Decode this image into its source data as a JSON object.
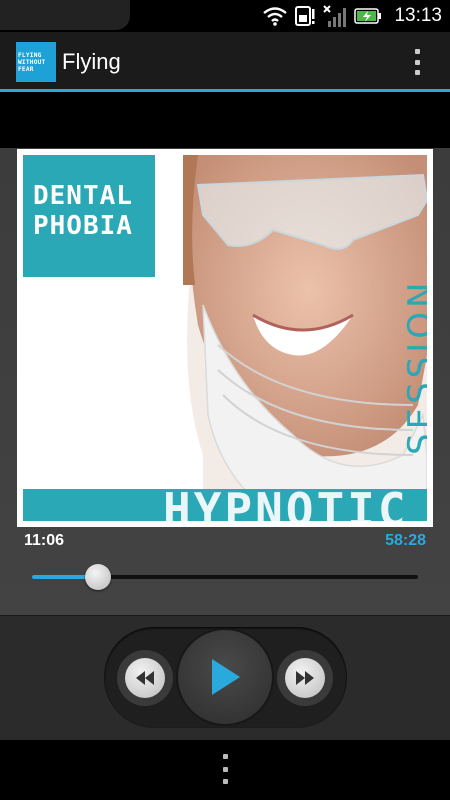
{
  "status_bar": {
    "time": "13:13",
    "icons": [
      "wifi-icon",
      "sim-icon",
      "signal-icon",
      "battery-charging-icon"
    ]
  },
  "action_bar": {
    "logo_lines": [
      "FLYING",
      "WITHOUT",
      "FEAR"
    ],
    "title": "Flying",
    "menu_icon": "overflow-menu-icon"
  },
  "album_art": {
    "title_line1": "DENTAL",
    "title_line2": "PHOBIA",
    "banner": "HYPNOTIC",
    "subtitle": "SESSION"
  },
  "player": {
    "elapsed": "11:06",
    "total": "58:28",
    "progress": 0.17
  },
  "controls": {
    "rewind_icon": "rewind-icon",
    "play_icon": "play-icon",
    "forward_icon": "fast-forward-icon"
  },
  "colors": {
    "accent": "#2aa9dc",
    "art_teal": "#2ba8b5"
  }
}
